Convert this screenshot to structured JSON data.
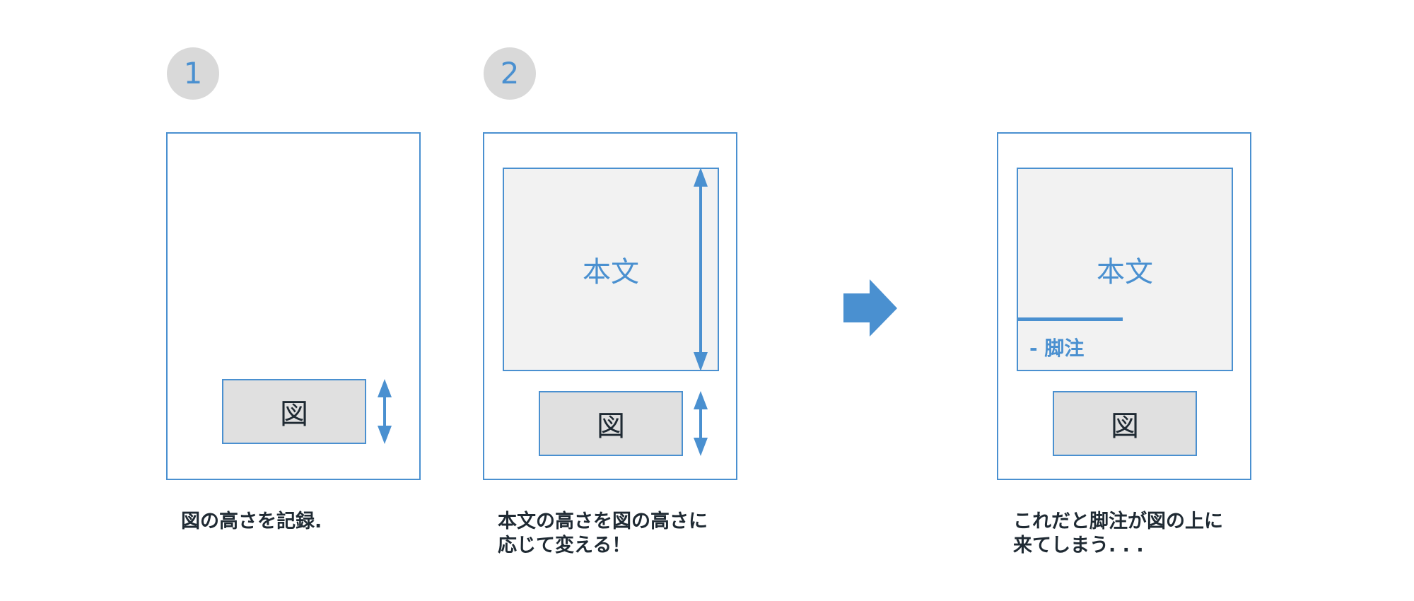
{
  "steps": {
    "step1": "1",
    "step2": "2"
  },
  "labels": {
    "honbun": "本文",
    "zu": "図",
    "footnote": "- 脚注"
  },
  "captions": {
    "caption1": "図の高さを記録.",
    "caption2": "本文の高さを図の高さに\n応じて変える！",
    "caption3": "これだと脚注が図の上に\n来てしまう. . ."
  },
  "colors": {
    "accent": "#4a90d0",
    "text": "#1f2a33",
    "body_fill": "#f2f2f2",
    "fig_fill": "#e0e0e0",
    "circle": "#d9d9d9"
  }
}
